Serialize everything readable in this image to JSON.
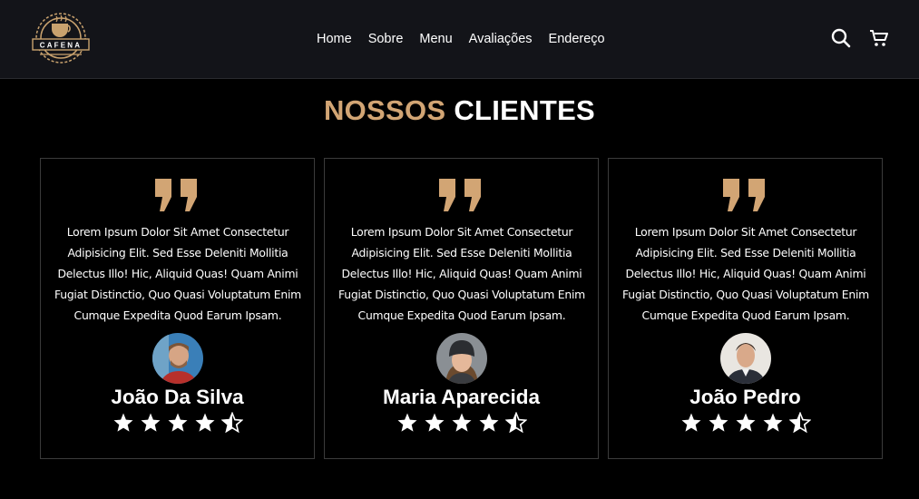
{
  "brand": {
    "name": "CAFENA",
    "accent_color": "#d2a574"
  },
  "nav": [
    {
      "label": "Home"
    },
    {
      "label": "Sobre"
    },
    {
      "label": "Menu"
    },
    {
      "label": "Avaliações"
    },
    {
      "label": "Endereço"
    }
  ],
  "header_icons": [
    "search-icon",
    "cart-icon"
  ],
  "section": {
    "title_accent": "NOSSOS",
    "title_main": "CLIENTES"
  },
  "testimonials": [
    {
      "text": "Lorem Ipsum Dolor Sit Amet Consectetur Adipisicing Elit. Sed Esse Deleniti Mollitia Delectus Illo! Hic, Aliquid Quas! Quam Animi Fugiat Distinctio, Quo Quasi Voluptatum Enim Cumque Expedita Quod Earum Ipsam.",
      "name": "João Da Silva",
      "rating": 4.5
    },
    {
      "text": "Lorem Ipsum Dolor Sit Amet Consectetur Adipisicing Elit. Sed Esse Deleniti Mollitia Delectus Illo! Hic, Aliquid Quas! Quam Animi Fugiat Distinctio, Quo Quasi Voluptatum Enim Cumque Expedita Quod Earum Ipsam.",
      "name": "Maria Aparecida",
      "rating": 4.5
    },
    {
      "text": "Lorem Ipsum Dolor Sit Amet Consectetur Adipisicing Elit. Sed Esse Deleniti Mollitia Delectus Illo! Hic, Aliquid Quas! Quam Animi Fugiat Distinctio, Quo Quasi Voluptatum Enim Cumque Expedita Quod Earum Ipsam.",
      "name": "João Pedro",
      "rating": 4.5
    }
  ]
}
